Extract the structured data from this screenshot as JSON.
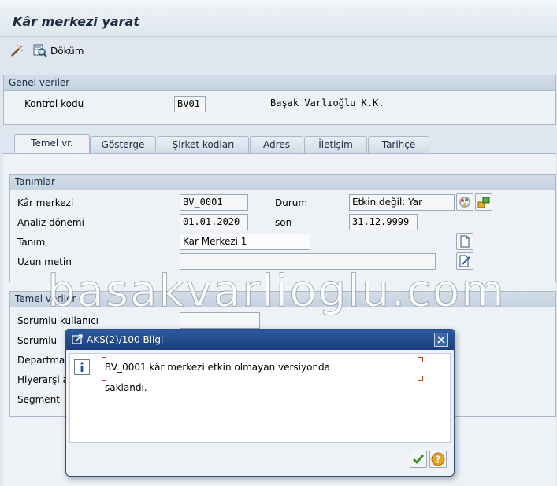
{
  "window": {
    "title": "Kâr merkezi yarat"
  },
  "toolbar": {
    "print_label": "Döküm"
  },
  "general": {
    "title": "Genel veriler",
    "control_area_label": "Kontrol kodu",
    "control_area_value": "BV01",
    "control_area_name": "Başak Varlıoğlu K.K."
  },
  "tabs": [
    {
      "label": "Temel vr."
    },
    {
      "label": "Gösterge"
    },
    {
      "label": "Şirket kodları"
    },
    {
      "label": "Adres"
    },
    {
      "label": "İletişim"
    },
    {
      "label": "Tarihçe"
    }
  ],
  "definitions": {
    "title": "Tanımlar",
    "profit_center_label": "Kâr merkezi",
    "profit_center_value": "BV_0001",
    "status_label": "Durum",
    "status_value": "Etkin değil: Yar",
    "analysis_period_label": "Analiz dönemi",
    "analysis_from": "01.01.2020",
    "to_label": "son",
    "analysis_to": "31.12.9999",
    "name_label": "Tanım",
    "name_value": "Kar Merkezi 1",
    "long_text_label": "Uzun metin",
    "long_text_value": ""
  },
  "basic": {
    "title": "Temel veriler",
    "rows": [
      {
        "label": "Sorumlu kullanıcı"
      },
      {
        "label": "Sorumlu"
      },
      {
        "label": "Departman"
      },
      {
        "label": "Hiyerarşi alanı"
      },
      {
        "label": "Segment"
      }
    ]
  },
  "watermark": "basakvarlioglu.com",
  "dialog": {
    "title": "AKS(2)/100 Bilgi",
    "message_line1": "BV_0001 kâr merkezi etkin olmayan versiyonda",
    "message_line2": "saklandı."
  },
  "colors": {
    "background": "#dfe6ef",
    "dialog_title": "#1b3f7a",
    "accent_green": "#3c8a1e",
    "accent_orange": "#e08a10"
  }
}
